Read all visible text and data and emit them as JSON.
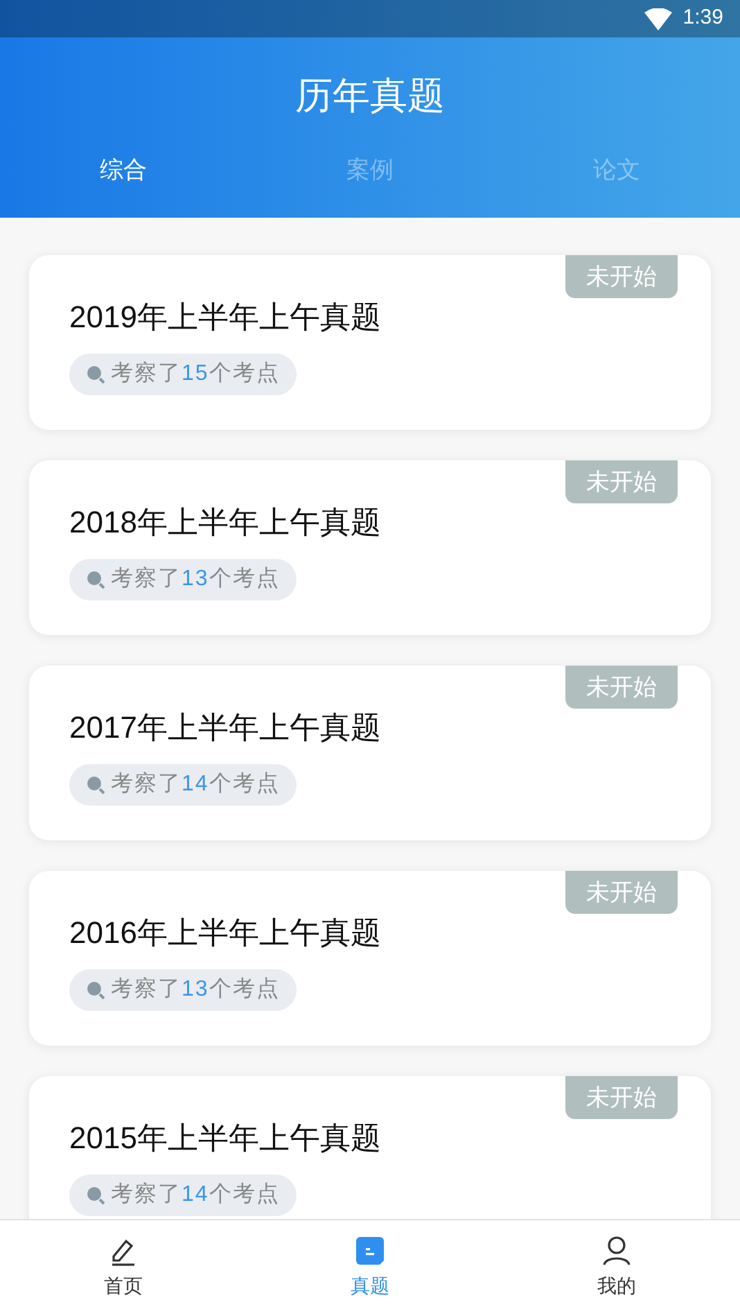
{
  "status_bar": {
    "time": "1:39"
  },
  "header": {
    "title": "历年真题"
  },
  "tabs": [
    {
      "label": "综合",
      "selected": true
    },
    {
      "label": "案例",
      "selected": false
    },
    {
      "label": "论文",
      "selected": false
    }
  ],
  "papers": [
    {
      "title": "2019年上半年上午真题",
      "status": "未开始",
      "stat_before": "考察了",
      "stat_count": "15",
      "stat_after": "个考点"
    },
    {
      "title": "2018年上半年上午真题",
      "status": "未开始",
      "stat_before": "考察了",
      "stat_count": "13",
      "stat_after": "个考点"
    },
    {
      "title": "2017年上半年上午真题",
      "status": "未开始",
      "stat_before": "考察了",
      "stat_count": "14",
      "stat_after": "个考点"
    },
    {
      "title": "2016年上半年上午真题",
      "status": "未开始",
      "stat_before": "考察了",
      "stat_count": "13",
      "stat_after": "个考点"
    },
    {
      "title": "2015年上半年上午真题",
      "status": "未开始",
      "stat_before": "考察了",
      "stat_count": "14",
      "stat_after": "个考点"
    }
  ],
  "bottom_nav": [
    {
      "label": "首页",
      "kind": "pencil",
      "selected": false
    },
    {
      "label": "真题",
      "kind": "doc",
      "selected": true
    },
    {
      "label": "我的",
      "kind": "user",
      "selected": false
    }
  ]
}
